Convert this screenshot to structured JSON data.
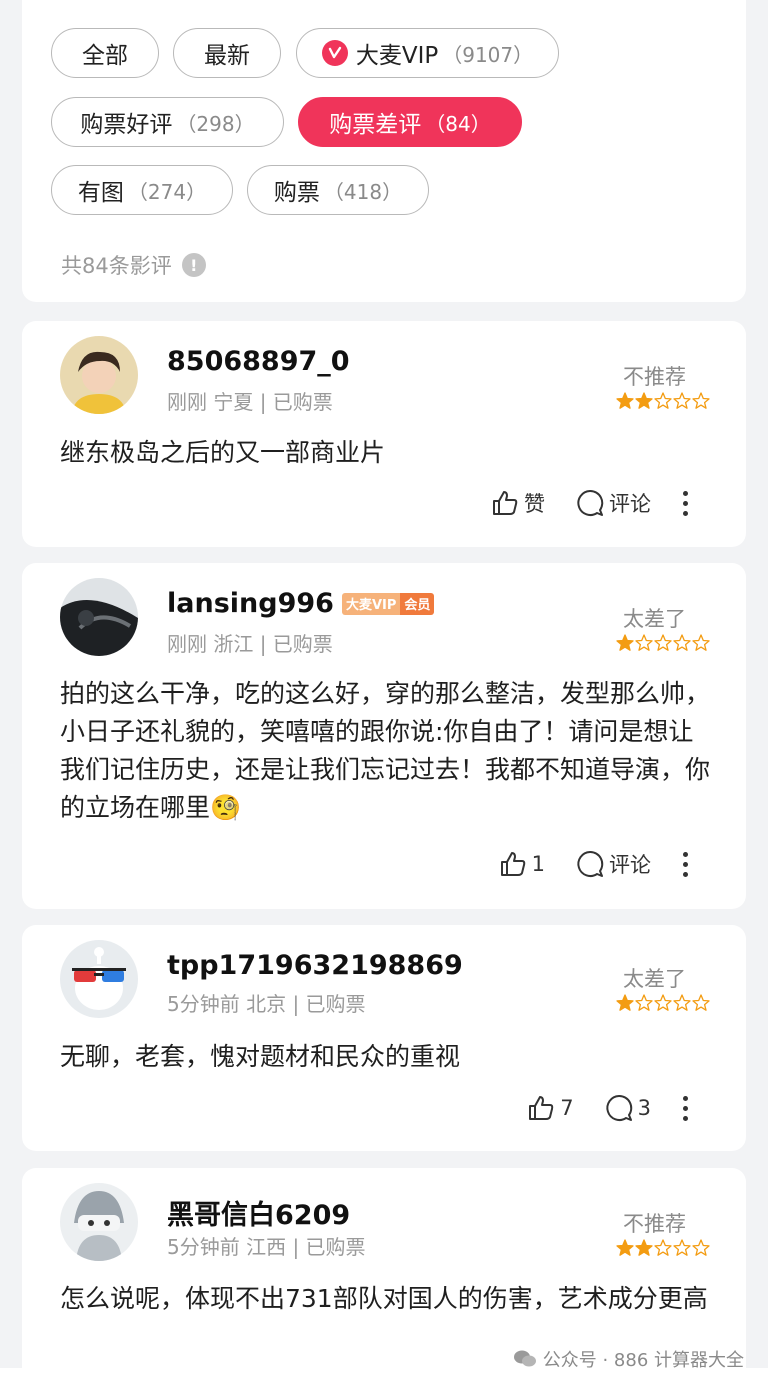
{
  "filters": {
    "chips": [
      {
        "label": "全部",
        "count": ""
      },
      {
        "label": "最新",
        "count": ""
      },
      {
        "label": "大麦VIP",
        "count": "（9107）"
      },
      {
        "label": "购票好评",
        "count": "（298）"
      },
      {
        "label": "购票差评",
        "count": "（84）"
      },
      {
        "label": "有图",
        "count": "（274）"
      },
      {
        "label": "购票",
        "count": "（418）"
      }
    ],
    "total_label": "共84条影评",
    "info_icon": "!",
    "active_color": "#f0345a"
  },
  "reviews": [
    {
      "username": "85068897_0",
      "meta": "刚刚 宁夏 | 已购票",
      "verdict": "不推荐",
      "stars": 2,
      "content": "继东极岛之后的又一部商业片",
      "like_label": "赞",
      "comment_label": "评论"
    },
    {
      "username": "lansing996",
      "vip_tag": {
        "left": "大麦VIP",
        "right": "会员"
      },
      "meta": "刚刚 浙江 | 已购票",
      "verdict": "太差了",
      "stars": 1,
      "content": "拍的这么干净，吃的这么好，穿的那么整洁，发型那么帅，小日子还礼貌的，笑嘻嘻的跟你说:你自由了！请问是想让我们记住历史，还是让我们忘记过去！我都不知道导演，你的立场在哪里🧐",
      "like_label": "1",
      "comment_label": "评论"
    },
    {
      "username": "tpp1719632198869",
      "meta": "5分钟前 北京 | 已购票",
      "verdict": "太差了",
      "stars": 1,
      "content": "无聊，老套，愧对题材和民众的重视",
      "like_label": "7",
      "comment_label": "3"
    },
    {
      "username": "黑哥信白6209",
      "meta": "5分钟前 江西 | 已购票",
      "verdict": "不推荐",
      "stars": 2,
      "content": "怎么说呢，体现不出731部队对国人的伤害，艺术成分更高"
    }
  ],
  "watermark": "公众号 · 886 计算器大全",
  "colors": {
    "star": "#f39c12",
    "star_empty": "#f39c12"
  }
}
